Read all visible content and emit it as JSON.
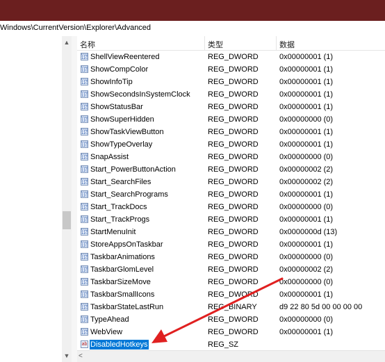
{
  "address": {
    "path": "Windows\\CurrentVersion\\Explorer\\Advanced"
  },
  "columns": {
    "name": "名称",
    "type": "类型",
    "data": "数据"
  },
  "scroll": {
    "up": "▲",
    "down": "▼",
    "left": "<"
  },
  "icons": {
    "dword": "registry-binary-value-icon",
    "string": "registry-string-value-icon",
    "dword_glyph": "011\n110",
    "string_glyph": "ab"
  },
  "rows": [
    {
      "name": "ShellViewReentered",
      "type": "REG_DWORD",
      "data": "0x00000001 (1)",
      "kind": "dword"
    },
    {
      "name": "ShowCompColor",
      "type": "REG_DWORD",
      "data": "0x00000001 (1)",
      "kind": "dword"
    },
    {
      "name": "ShowInfoTip",
      "type": "REG_DWORD",
      "data": "0x00000001 (1)",
      "kind": "dword"
    },
    {
      "name": "ShowSecondsInSystemClock",
      "type": "REG_DWORD",
      "data": "0x00000001 (1)",
      "kind": "dword"
    },
    {
      "name": "ShowStatusBar",
      "type": "REG_DWORD",
      "data": "0x00000001 (1)",
      "kind": "dword"
    },
    {
      "name": "ShowSuperHidden",
      "type": "REG_DWORD",
      "data": "0x00000000 (0)",
      "kind": "dword"
    },
    {
      "name": "ShowTaskViewButton",
      "type": "REG_DWORD",
      "data": "0x00000001 (1)",
      "kind": "dword"
    },
    {
      "name": "ShowTypeOverlay",
      "type": "REG_DWORD",
      "data": "0x00000001 (1)",
      "kind": "dword"
    },
    {
      "name": "SnapAssist",
      "type": "REG_DWORD",
      "data": "0x00000000 (0)",
      "kind": "dword"
    },
    {
      "name": "Start_PowerButtonAction",
      "type": "REG_DWORD",
      "data": "0x00000002 (2)",
      "kind": "dword"
    },
    {
      "name": "Start_SearchFiles",
      "type": "REG_DWORD",
      "data": "0x00000002 (2)",
      "kind": "dword"
    },
    {
      "name": "Start_SearchPrograms",
      "type": "REG_DWORD",
      "data": "0x00000001 (1)",
      "kind": "dword"
    },
    {
      "name": "Start_TrackDocs",
      "type": "REG_DWORD",
      "data": "0x00000000 (0)",
      "kind": "dword"
    },
    {
      "name": "Start_TrackProgs",
      "type": "REG_DWORD",
      "data": "0x00000001 (1)",
      "kind": "dword"
    },
    {
      "name": "StartMenuInit",
      "type": "REG_DWORD",
      "data": "0x0000000d (13)",
      "kind": "dword"
    },
    {
      "name": "StoreAppsOnTaskbar",
      "type": "REG_DWORD",
      "data": "0x00000001 (1)",
      "kind": "dword"
    },
    {
      "name": "TaskbarAnimations",
      "type": "REG_DWORD",
      "data": "0x00000000 (0)",
      "kind": "dword"
    },
    {
      "name": "TaskbarGlomLevel",
      "type": "REG_DWORD",
      "data": "0x00000002 (2)",
      "kind": "dword"
    },
    {
      "name": "TaskbarSizeMove",
      "type": "REG_DWORD",
      "data": "0x00000000 (0)",
      "kind": "dword"
    },
    {
      "name": "TaskbarSmallIcons",
      "type": "REG_DWORD",
      "data": "0x00000001 (1)",
      "kind": "dword"
    },
    {
      "name": "TaskbarStateLastRun",
      "type": "REG_BINARY",
      "data": "d9 22 80 5d 00 00 00 00",
      "kind": "dword"
    },
    {
      "name": "TypeAhead",
      "type": "REG_DWORD",
      "data": "0x00000000 (0)",
      "kind": "dword"
    },
    {
      "name": "WebView",
      "type": "REG_DWORD",
      "data": "0x00000001 (1)",
      "kind": "dword"
    },
    {
      "name": "DisabledHotkeys",
      "type": "REG_SZ",
      "data": "",
      "kind": "string",
      "selected": true
    }
  ],
  "colors": {
    "titlebar": "#6b1f1f",
    "selection": "#0078d7",
    "annotation_arrow": "#e02020"
  }
}
